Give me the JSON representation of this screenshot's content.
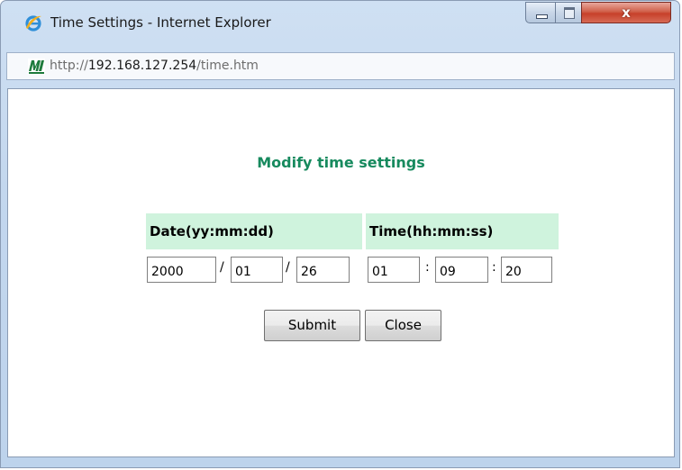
{
  "window": {
    "title": "Time Settings - Internet Explorer",
    "close_glyph": "x",
    "controls": [
      "minimize-icon",
      "maximize-icon",
      "close-icon"
    ]
  },
  "address_bar": {
    "scheme": "http://",
    "host": "192.168.127.254",
    "path": "/time.htm",
    "site_icon": "moxa-logo-icon"
  },
  "page": {
    "heading": "Modify time settings",
    "date_header": "Date(yy:mm:dd)",
    "time_header": "Time(hh:mm:ss)",
    "date_sep": "/",
    "time_sep": ":",
    "date": {
      "yy": "2000",
      "mm": "01",
      "dd": "26"
    },
    "time": {
      "hh": "01",
      "mm": "09",
      "ss": "20"
    },
    "submit_label": "Submit",
    "close_label": "Close"
  },
  "colors": {
    "heading": "#178a5e",
    "header_bg": "#cff3dd",
    "window_frame": "#c3d7ee",
    "close_button": "#c7402a"
  }
}
